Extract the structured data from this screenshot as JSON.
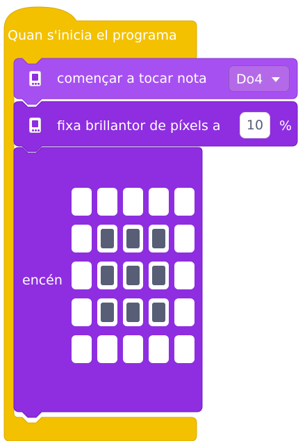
{
  "colors": {
    "hat": "#f3c100",
    "hat_stroke": "#d9a900",
    "block": "#8e2ee0",
    "block_light": "#a750f2",
    "block_stroke": "#6d1ab8",
    "led_on": "#575e75",
    "led_off": "#ffffff"
  },
  "hat": {
    "label": "Quan s'inicia el programa"
  },
  "play_block": {
    "label": "començar a tocar nota",
    "note_value": "Do4",
    "icon": "microbit-icon"
  },
  "brightness_block": {
    "label": "fixa brillantor de píxels a",
    "value": "10",
    "unit": "%",
    "icon": "microbit-icon"
  },
  "light_block": {
    "label": "encén",
    "matrix": [
      [
        0,
        0,
        0,
        0,
        0
      ],
      [
        0,
        1,
        1,
        1,
        0
      ],
      [
        0,
        1,
        1,
        1,
        0
      ],
      [
        0,
        1,
        1,
        1,
        0
      ],
      [
        0,
        0,
        0,
        0,
        0
      ]
    ]
  }
}
